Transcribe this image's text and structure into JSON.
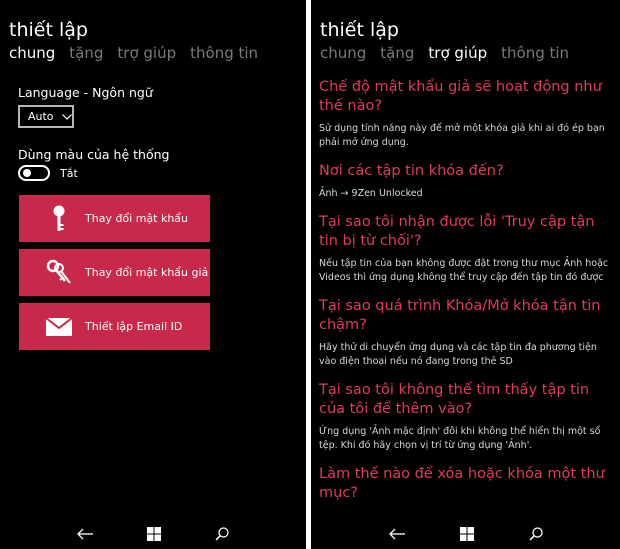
{
  "left": {
    "title": "thiết lập",
    "tabs": [
      "chung",
      "tặng",
      "trợ giúp",
      "thông tin"
    ],
    "language_label": "Language - Ngôn ngữ",
    "language_value": "Auto",
    "system_color_label": "Dùng màu của hệ thống",
    "toggle_state": "Tắt",
    "buttons": {
      "change_password": "Thay đổi mật khẩu",
      "change_fake_password": "Thay đổi mật khẩu giả",
      "setup_email": "Thiết lập Email ID"
    }
  },
  "right": {
    "title": "thiết lập",
    "tabs": [
      "chung",
      "tặng",
      "trợ giúp",
      "thông tin"
    ],
    "faq": [
      {
        "q": "Chế độ mật khẩu giả sẽ hoạt động như thế nào?",
        "a": "Sử dụng tính năng này để mở một khóa giả khi ai đó ép bạn phải mở ứng dụng."
      },
      {
        "q": "Nơi các tập tin khóa đến?",
        "a": "Ảnh → 9Zen Unlocked"
      },
      {
        "q": "Tại sao tôi nhận được lỗi 'Truy cập tận tin bị từ chối'?",
        "a": "Nếu tập tin của bạn không được đặt trong thư mục Ảnh hoặc Videos thì ứng dụng không thể truy cập đến tập tin đó được"
      },
      {
        "q": "Tại sao quá trình Khóa/Mở khóa tận tin chậm?",
        "a": "Hãy thử di chuyển ứng dụng và các tập tin đa phương tiện vào điện thoại nếu nó đang trong thẻ SD"
      },
      {
        "q": "Tại sao tôi không thể tìm thấy tập tin của tôi để thêm vào?",
        "a": "Ứng dụng 'Ảnh mặc định' đôi khi không thể hiển thị một số tệp. Khi đó hãy chọn vị trí  từ ứng dụng 'Ảnh'."
      },
      {
        "q": "Làm thế nào để xóa hoặc khóa một thư mục?",
        "a": ""
      }
    ]
  },
  "colors": {
    "accent": "#c8294a",
    "faq_question": "#e23a5b",
    "background": "#000000",
    "inactive_tab": "#7a7a7a"
  },
  "icons": [
    "key-icon",
    "keys-icon",
    "envelope-icon",
    "back-icon",
    "windows-icon",
    "search-icon",
    "chevron-down-icon"
  ]
}
